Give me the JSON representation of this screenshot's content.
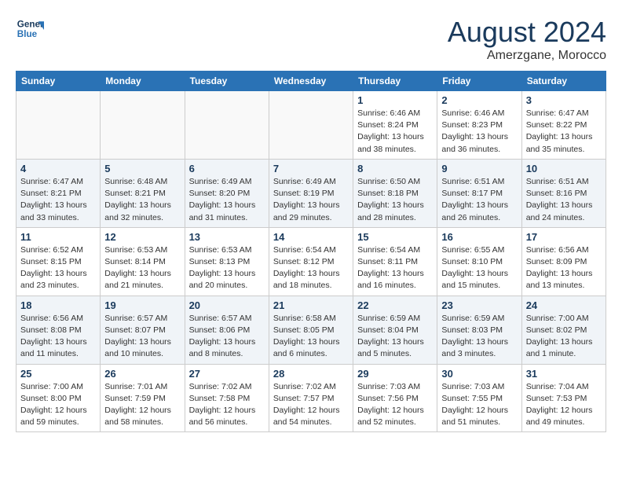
{
  "header": {
    "logo_line1": "General",
    "logo_line2": "Blue",
    "title": "August 2024",
    "subtitle": "Amerzgane, Morocco"
  },
  "days_of_week": [
    "Sunday",
    "Monday",
    "Tuesday",
    "Wednesday",
    "Thursday",
    "Friday",
    "Saturday"
  ],
  "weeks": [
    [
      {
        "day": "",
        "info": ""
      },
      {
        "day": "",
        "info": ""
      },
      {
        "day": "",
        "info": ""
      },
      {
        "day": "",
        "info": ""
      },
      {
        "day": "1",
        "info": "Sunrise: 6:46 AM\nSunset: 8:24 PM\nDaylight: 13 hours\nand 38 minutes."
      },
      {
        "day": "2",
        "info": "Sunrise: 6:46 AM\nSunset: 8:23 PM\nDaylight: 13 hours\nand 36 minutes."
      },
      {
        "day": "3",
        "info": "Sunrise: 6:47 AM\nSunset: 8:22 PM\nDaylight: 13 hours\nand 35 minutes."
      }
    ],
    [
      {
        "day": "4",
        "info": "Sunrise: 6:47 AM\nSunset: 8:21 PM\nDaylight: 13 hours\nand 33 minutes."
      },
      {
        "day": "5",
        "info": "Sunrise: 6:48 AM\nSunset: 8:21 PM\nDaylight: 13 hours\nand 32 minutes."
      },
      {
        "day": "6",
        "info": "Sunrise: 6:49 AM\nSunset: 8:20 PM\nDaylight: 13 hours\nand 31 minutes."
      },
      {
        "day": "7",
        "info": "Sunrise: 6:49 AM\nSunset: 8:19 PM\nDaylight: 13 hours\nand 29 minutes."
      },
      {
        "day": "8",
        "info": "Sunrise: 6:50 AM\nSunset: 8:18 PM\nDaylight: 13 hours\nand 28 minutes."
      },
      {
        "day": "9",
        "info": "Sunrise: 6:51 AM\nSunset: 8:17 PM\nDaylight: 13 hours\nand 26 minutes."
      },
      {
        "day": "10",
        "info": "Sunrise: 6:51 AM\nSunset: 8:16 PM\nDaylight: 13 hours\nand 24 minutes."
      }
    ],
    [
      {
        "day": "11",
        "info": "Sunrise: 6:52 AM\nSunset: 8:15 PM\nDaylight: 13 hours\nand 23 minutes."
      },
      {
        "day": "12",
        "info": "Sunrise: 6:53 AM\nSunset: 8:14 PM\nDaylight: 13 hours\nand 21 minutes."
      },
      {
        "day": "13",
        "info": "Sunrise: 6:53 AM\nSunset: 8:13 PM\nDaylight: 13 hours\nand 20 minutes."
      },
      {
        "day": "14",
        "info": "Sunrise: 6:54 AM\nSunset: 8:12 PM\nDaylight: 13 hours\nand 18 minutes."
      },
      {
        "day": "15",
        "info": "Sunrise: 6:54 AM\nSunset: 8:11 PM\nDaylight: 13 hours\nand 16 minutes."
      },
      {
        "day": "16",
        "info": "Sunrise: 6:55 AM\nSunset: 8:10 PM\nDaylight: 13 hours\nand 15 minutes."
      },
      {
        "day": "17",
        "info": "Sunrise: 6:56 AM\nSunset: 8:09 PM\nDaylight: 13 hours\nand 13 minutes."
      }
    ],
    [
      {
        "day": "18",
        "info": "Sunrise: 6:56 AM\nSunset: 8:08 PM\nDaylight: 13 hours\nand 11 minutes."
      },
      {
        "day": "19",
        "info": "Sunrise: 6:57 AM\nSunset: 8:07 PM\nDaylight: 13 hours\nand 10 minutes."
      },
      {
        "day": "20",
        "info": "Sunrise: 6:57 AM\nSunset: 8:06 PM\nDaylight: 13 hours\nand 8 minutes."
      },
      {
        "day": "21",
        "info": "Sunrise: 6:58 AM\nSunset: 8:05 PM\nDaylight: 13 hours\nand 6 minutes."
      },
      {
        "day": "22",
        "info": "Sunrise: 6:59 AM\nSunset: 8:04 PM\nDaylight: 13 hours\nand 5 minutes."
      },
      {
        "day": "23",
        "info": "Sunrise: 6:59 AM\nSunset: 8:03 PM\nDaylight: 13 hours\nand 3 minutes."
      },
      {
        "day": "24",
        "info": "Sunrise: 7:00 AM\nSunset: 8:02 PM\nDaylight: 13 hours\nand 1 minute."
      }
    ],
    [
      {
        "day": "25",
        "info": "Sunrise: 7:00 AM\nSunset: 8:00 PM\nDaylight: 12 hours\nand 59 minutes."
      },
      {
        "day": "26",
        "info": "Sunrise: 7:01 AM\nSunset: 7:59 PM\nDaylight: 12 hours\nand 58 minutes."
      },
      {
        "day": "27",
        "info": "Sunrise: 7:02 AM\nSunset: 7:58 PM\nDaylight: 12 hours\nand 56 minutes."
      },
      {
        "day": "28",
        "info": "Sunrise: 7:02 AM\nSunset: 7:57 PM\nDaylight: 12 hours\nand 54 minutes."
      },
      {
        "day": "29",
        "info": "Sunrise: 7:03 AM\nSunset: 7:56 PM\nDaylight: 12 hours\nand 52 minutes."
      },
      {
        "day": "30",
        "info": "Sunrise: 7:03 AM\nSunset: 7:55 PM\nDaylight: 12 hours\nand 51 minutes."
      },
      {
        "day": "31",
        "info": "Sunrise: 7:04 AM\nSunset: 7:53 PM\nDaylight: 12 hours\nand 49 minutes."
      }
    ]
  ]
}
